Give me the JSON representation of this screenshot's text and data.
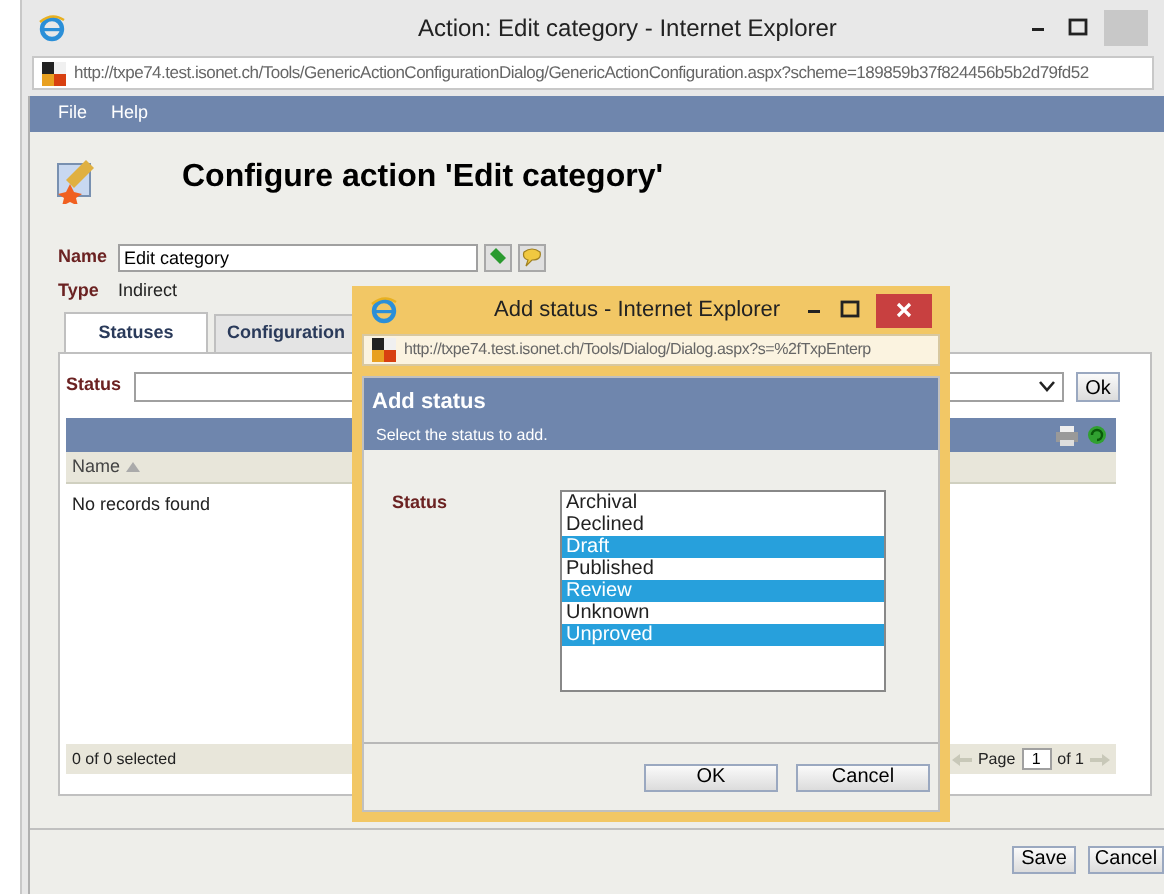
{
  "window": {
    "title": "Action: Edit category - Internet Explorer",
    "url": "http://txpe74.test.isonet.ch/Tools/GenericActionConfigurationDialog/GenericActionConfiguration.aspx?scheme=189859b37f824456b5b2d79fd52"
  },
  "menu": [
    "File",
    "Help"
  ],
  "heading": "Configure action 'Edit category'",
  "name_field": {
    "label": "Name",
    "value": "Edit category"
  },
  "type_field": {
    "label": "Type",
    "value": "Indirect"
  },
  "tabs": [
    {
      "label": "Statuses",
      "selected": true
    },
    {
      "label": "Configuration",
      "selected": false
    }
  ],
  "status_row": {
    "label": "Status",
    "button": "Ok"
  },
  "grid": {
    "column": "Name",
    "empty": "No records found",
    "footer": "0 of 0 selected",
    "pager": {
      "label": "Page",
      "value": "1",
      "of": "of 1"
    }
  },
  "buttons": [
    "Save",
    "Cancel"
  ],
  "dialog": {
    "title": "Add status - Internet Explorer",
    "url": "http://txpe74.test.isonet.ch/Tools/Dialog/Dialog.aspx?s=%2fTxpEnterp",
    "heading": "Add status",
    "subtitle": "Select the status to add.",
    "label": "Status",
    "options": [
      {
        "label": "Archival",
        "selected": false
      },
      {
        "label": "Declined",
        "selected": false
      },
      {
        "label": "Draft",
        "selected": true
      },
      {
        "label": "Published",
        "selected": false
      },
      {
        "label": "Review",
        "selected": true
      },
      {
        "label": "Unknown",
        "selected": false
      },
      {
        "label": "Unproved",
        "selected": true
      }
    ],
    "buttons": [
      "OK",
      "Cancel"
    ]
  }
}
